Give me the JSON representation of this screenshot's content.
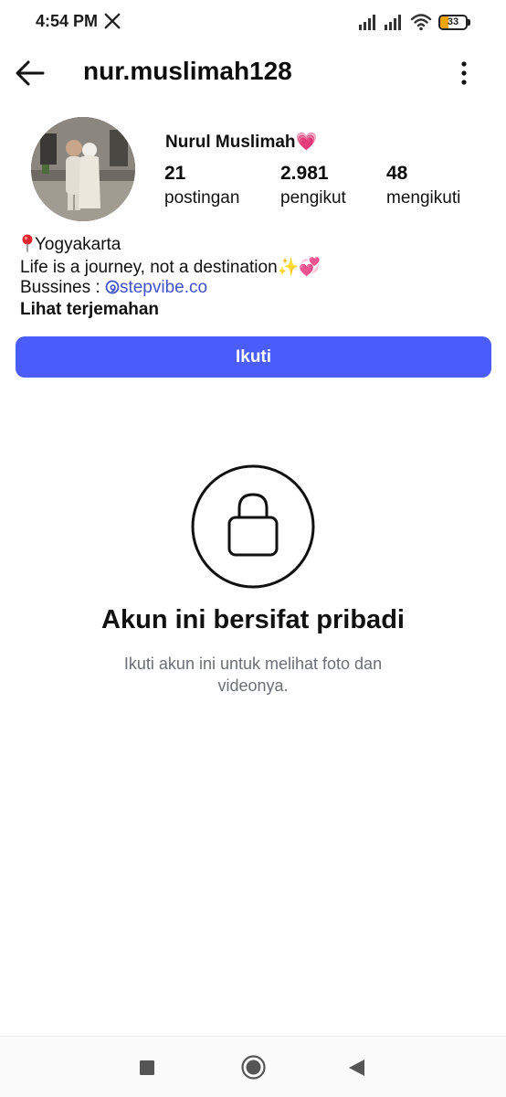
{
  "status_bar": {
    "time": "4:54 PM",
    "battery_level": "33",
    "icons": [
      "x-logo-icon",
      "signal-icon",
      "signal-icon",
      "wifi-icon",
      "battery-icon"
    ]
  },
  "header": {
    "username": "nur.muslimah128",
    "icons": [
      "back-arrow-icon",
      "more-options-icon"
    ]
  },
  "profile": {
    "display_name": "Nurul Muslimah💗",
    "stats": {
      "posts_count": "21",
      "posts_label": "postingan",
      "followers_count": "2.981",
      "followers_label": "pengikut",
      "following_count": "48",
      "following_label": "mengikuti"
    },
    "bio": {
      "location": "Yogyakarta",
      "tagline": "Life is a journey, not a destination✨💞",
      "business_prefix": "Bussines : ",
      "business_handle": "stepvibe.co",
      "translate_label": "Lihat terjemahan"
    }
  },
  "follow_button": {
    "label": "Ikuti",
    "color": "#4a5dfb"
  },
  "private_notice": {
    "title": "Akun ini bersifat pribadi",
    "description": "Ikuti akun ini untuk melihat foto dan videonya.",
    "icon": "lock-icon"
  },
  "nav_bar": {
    "icons": [
      "recent-apps-icon",
      "home-icon",
      "back-icon"
    ]
  },
  "colors": {
    "accent": "#4a5dfb",
    "link": "#3f51c8",
    "muted_text": "#6b6f75",
    "battery": "#f0a500"
  }
}
